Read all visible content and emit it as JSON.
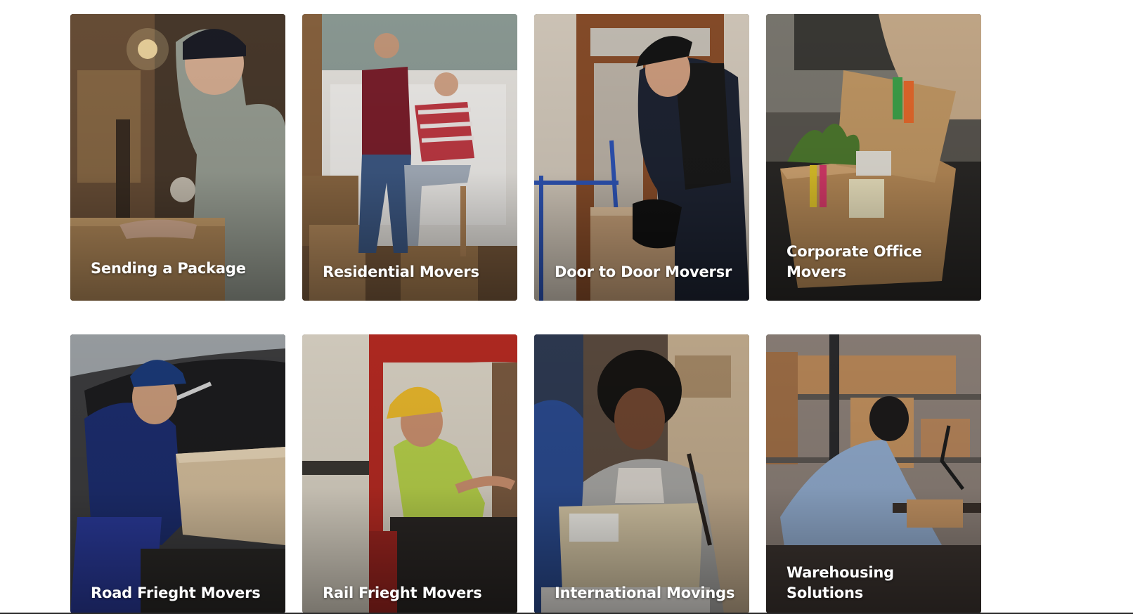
{
  "services": [
    {
      "title": "Sending a Package",
      "photo": "courier-taping-box"
    },
    {
      "title": "Residential Movers",
      "photo": "couple-with-tablet"
    },
    {
      "title": "Door to Door Moversr",
      "photo": "courier-with-hand-truck"
    },
    {
      "title": "Corporate Office Movers",
      "photo": "office-supplies-box"
    },
    {
      "title": "Road Frieght Movers",
      "photo": "worker-loading-van"
    },
    {
      "title": "Rail Frieght Movers",
      "photo": "forklift-operator"
    },
    {
      "title": "International Movings",
      "photo": "woman-holding-parcel"
    },
    {
      "title": "Warehousing Solutions",
      "photo": "warehouse-worker-at-desk"
    }
  ],
  "colors": {
    "page_background": "#ffffff",
    "title_text": "#ffffff",
    "bottom_rule": "#2a2a2a"
  }
}
